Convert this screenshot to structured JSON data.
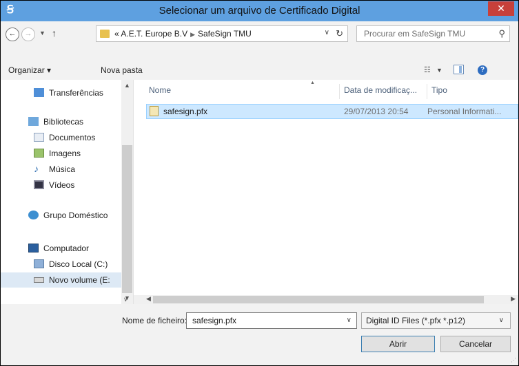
{
  "window": {
    "title": "Selecionar um arquivo de Certificado Digital",
    "app_icon": "Ꞩ",
    "close": "✕"
  },
  "address": {
    "prefix": "«",
    "crumbs": [
      "A.E.T. Europe B.V",
      "SafeSign TMU"
    ],
    "search_placeholder": "Procurar em SafeSign TMU"
  },
  "toolbar": {
    "organize": "Organizar ▾",
    "new_folder": "Nova pasta"
  },
  "sidebar": {
    "items": [
      {
        "label": "Transferências"
      },
      {
        "label": "Bibliotecas"
      },
      {
        "label": "Documentos"
      },
      {
        "label": "Imagens"
      },
      {
        "label": "Música"
      },
      {
        "label": "Vídeos"
      },
      {
        "label": "Grupo Doméstico"
      },
      {
        "label": "Computador"
      },
      {
        "label": "Disco Local (C:)"
      },
      {
        "label": "Novo volume (E:"
      }
    ]
  },
  "files": {
    "columns": [
      "Nome",
      "Data de modificaç...",
      "Tipo"
    ],
    "rows": [
      {
        "name": "safesign.pfx",
        "date": "29/07/2013 20:54",
        "type": "Personal Informati..."
      }
    ]
  },
  "bottom": {
    "filename_label": "Nome de ficheiro:",
    "filename_value": "safesign.pfx",
    "filter_value": "Digital ID Files (*.pfx *.p12)",
    "open_label": "Abrir",
    "cancel_label": "Cancelar"
  },
  "colors": {
    "titlebar": "#5ea0e0",
    "close": "#c7403a",
    "selection": "#cde8ff"
  }
}
